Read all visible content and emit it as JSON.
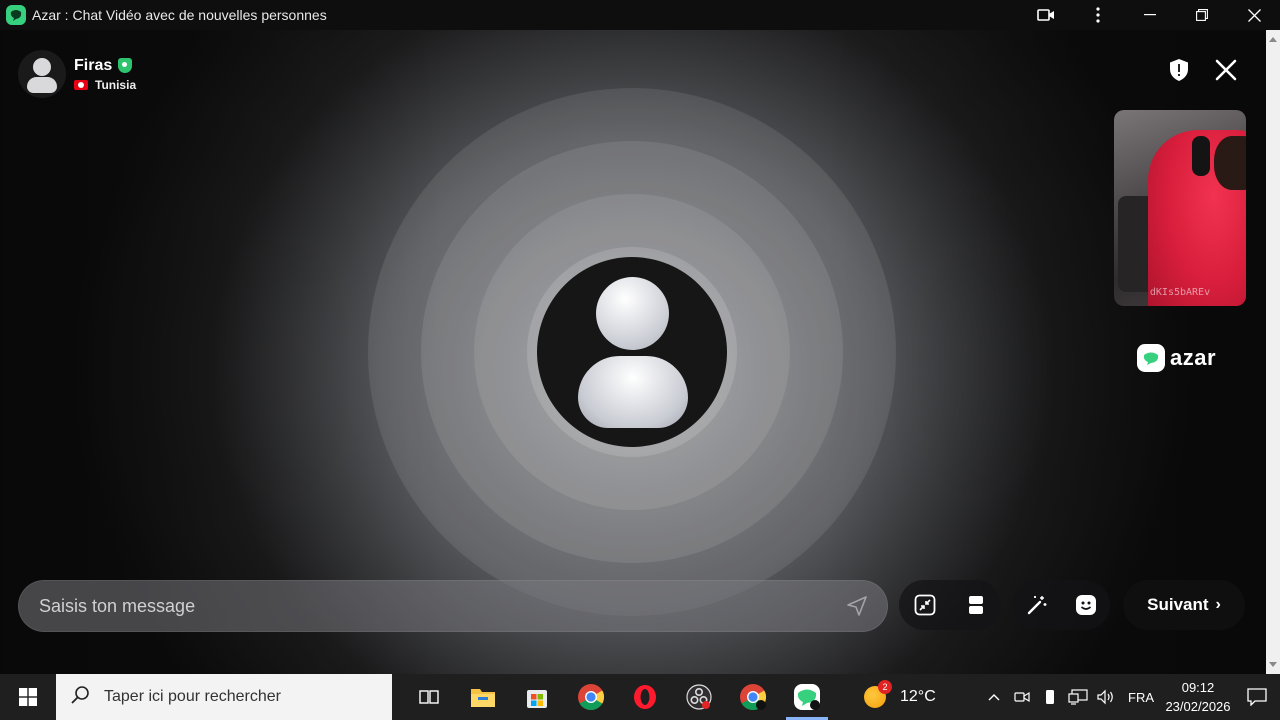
{
  "window": {
    "title": "Azar : Chat Vidéo avec de nouvelles personnes"
  },
  "peer": {
    "name": "Firas",
    "country": "Tunisia"
  },
  "self_view": {
    "watermark": "dKIs5bAREv"
  },
  "brand": {
    "name": "azar"
  },
  "chat": {
    "placeholder": "Saisis ton message"
  },
  "controls": {
    "next_label": "Suivant"
  },
  "taskbar": {
    "search_placeholder": "Taper ici pour rechercher",
    "weather_temp": "12°C",
    "weather_badge": "2",
    "language": "FRA",
    "time": "09:12",
    "date": "23/02/2026"
  },
  "colors": {
    "brand_green": "#37d07f",
    "verified_green": "#2ec46d",
    "tunisia_red": "#e70013"
  }
}
